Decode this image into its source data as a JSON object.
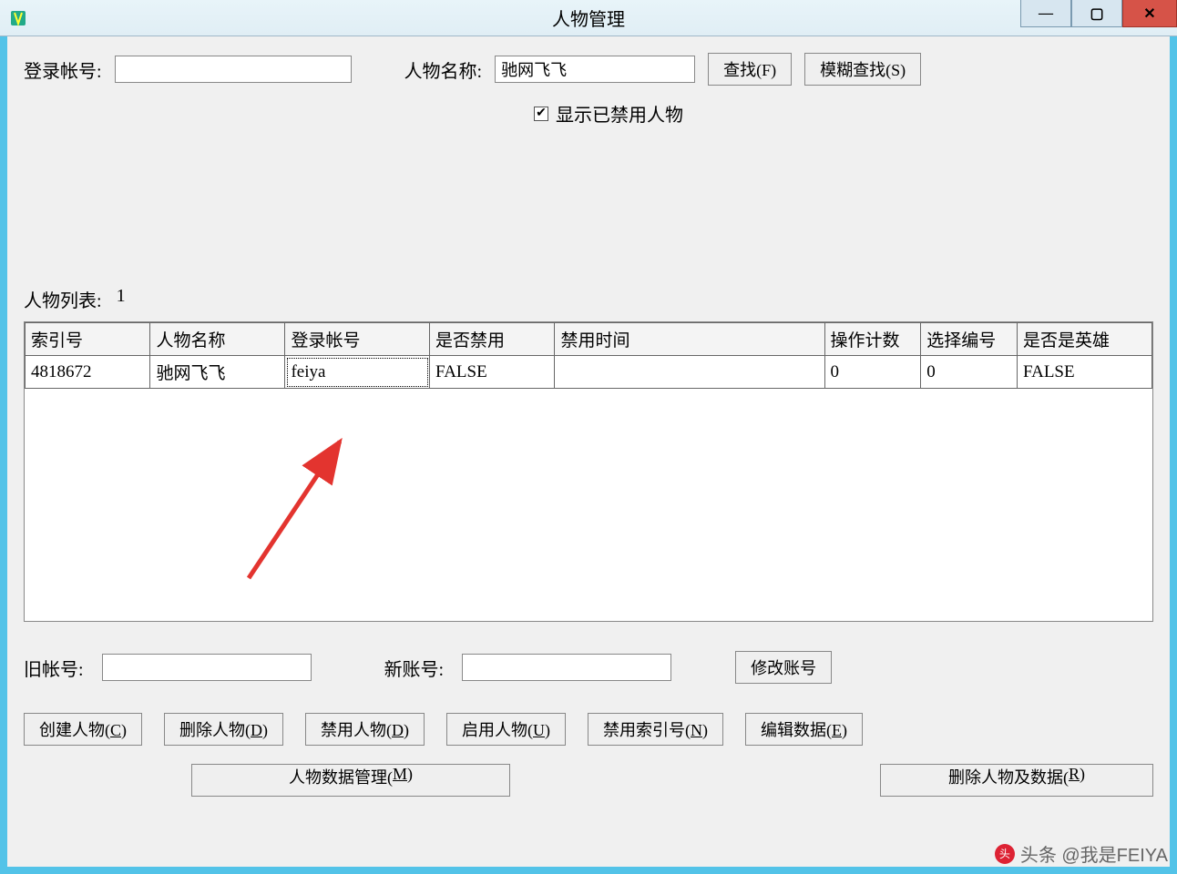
{
  "titlebar": {
    "title": "人物管理"
  },
  "search": {
    "login_label": "登录帐号:",
    "login_value": "",
    "name_label": "人物名称:",
    "name_value": "驰网飞飞",
    "find_label": "查找(F)",
    "fuzzy_label": "模糊查找(S)",
    "show_disabled_label": "显示已禁用人物"
  },
  "list": {
    "label": "人物列表:",
    "count": "1",
    "headers": [
      "索引号",
      "人物名称",
      "登录帐号",
      "是否禁用",
      "禁用时间",
      "操作计数",
      "选择编号",
      "是否是英雄"
    ],
    "rows": [
      {
        "cells": [
          "4818672",
          "驰网飞飞",
          "feiya",
          "FALSE",
          "",
          "0",
          "0",
          "FALSE"
        ]
      }
    ]
  },
  "account": {
    "old_label": "旧帐号:",
    "old_value": "",
    "new_label": "新账号:",
    "new_value": "",
    "modify_label": "修改账号"
  },
  "buttons": {
    "create": "创建人物(C)",
    "delete": "删除人物(D)",
    "disable": "禁用人物(D)",
    "enable": "启用人物(U)",
    "disable_index": "禁用索引号(N)",
    "edit_data": "编辑数据(E)",
    "data_manage": "人物数据管理(M)",
    "delete_data": "删除人物及数据(R)"
  },
  "watermark": "头条 @我是FEIYA"
}
